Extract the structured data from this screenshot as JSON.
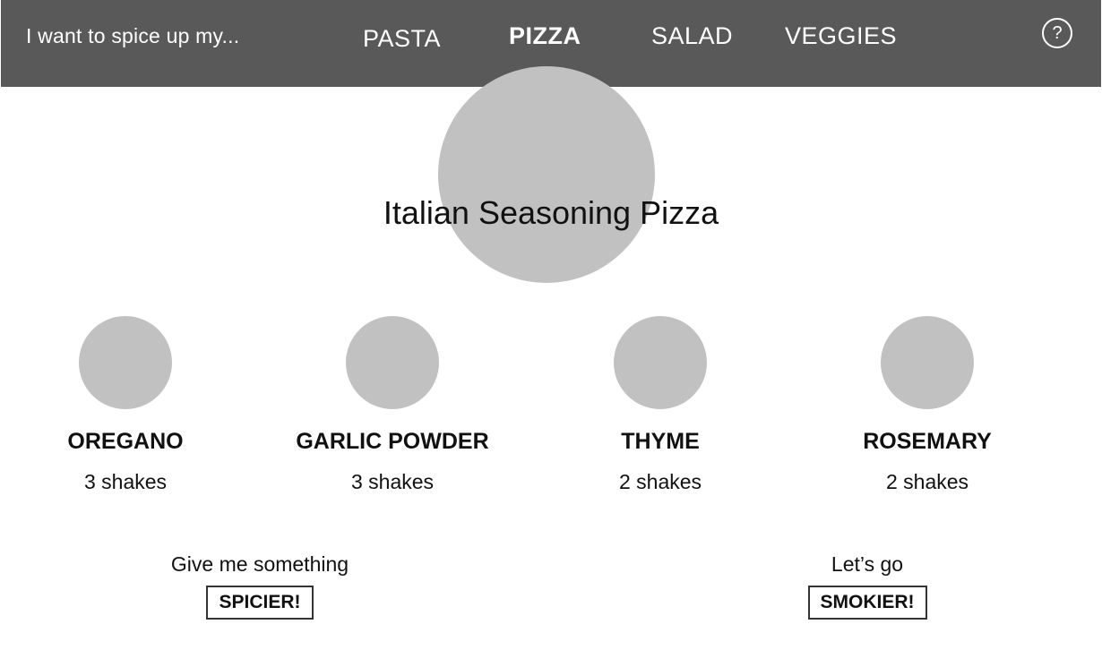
{
  "nav": {
    "prompt": "I want to spice up my...",
    "tabs": [
      {
        "label": "PASTA",
        "active": false
      },
      {
        "label": "PIZZA",
        "active": true
      },
      {
        "label": "SALAD",
        "active": false
      },
      {
        "label": "VEGGIES",
        "active": false
      }
    ],
    "help_label": "?"
  },
  "recipe": {
    "title": "Italian Seasoning Pizza"
  },
  "spices": [
    {
      "name": "OREGANO",
      "amount": "3 shakes"
    },
    {
      "name": "GARLIC POWDER",
      "amount": "3 shakes"
    },
    {
      "name": "THYME",
      "amount": "2 shakes"
    },
    {
      "name": "ROSEMARY",
      "amount": "2 shakes"
    }
  ],
  "actions": {
    "spicier": {
      "caption": "Give me something",
      "button": "SPICIER!"
    },
    "smokier": {
      "caption": "Let’s go",
      "button": "SMOKIER!"
    }
  },
  "colors": {
    "navbar": "#595959",
    "placeholder_image": "#c1c1c1"
  }
}
